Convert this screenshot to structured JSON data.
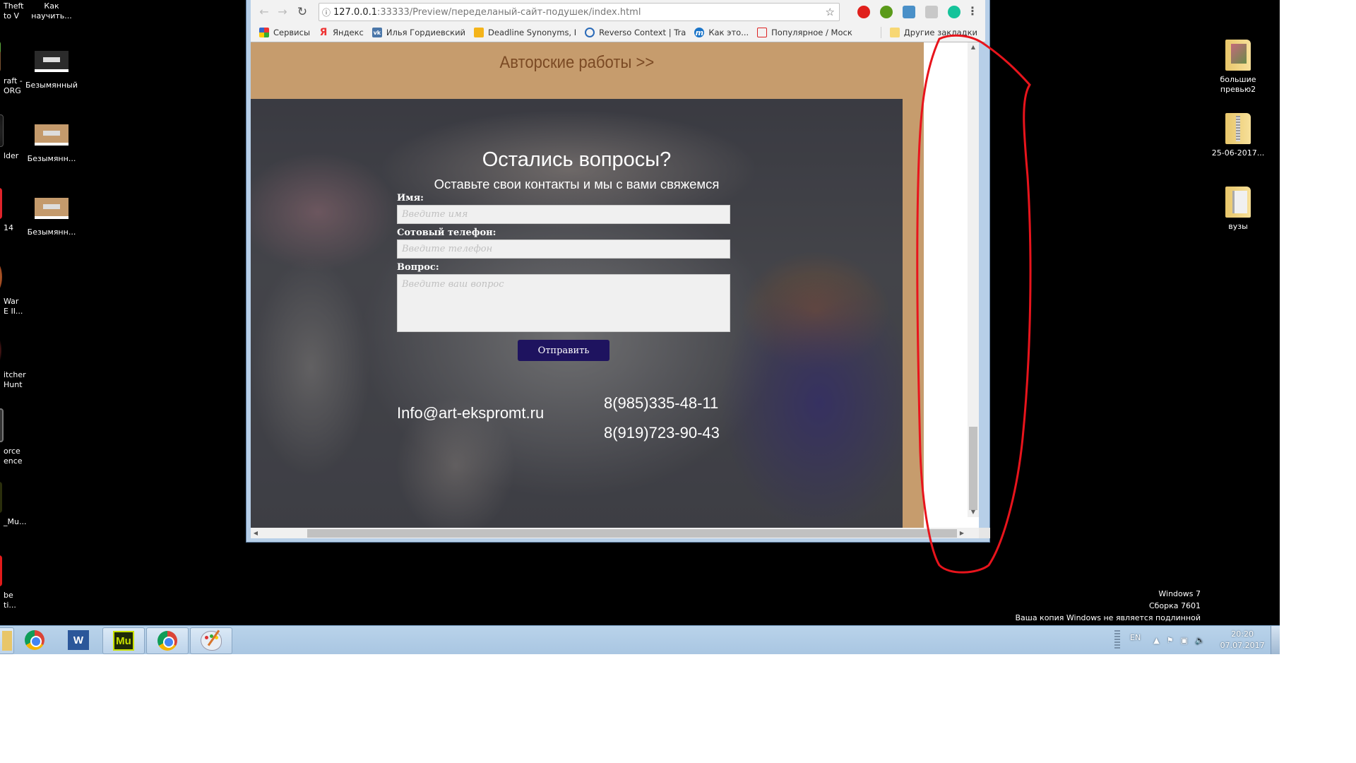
{
  "desktop": {
    "left_icons": [
      {
        "label": "Theft\nto V"
      },
      {
        "label": "Как\nнаучить..."
      },
      {
        "label": "raft -\nORG"
      },
      {
        "label": "Безымянный"
      },
      {
        "label": "lder"
      },
      {
        "label": "Безымянн..."
      },
      {
        "label": "14"
      },
      {
        "label": "Безымянн..."
      },
      {
        "label": "War\nE II..."
      },
      {
        "label": "itcher\nHunt"
      },
      {
        "label": "orce\nence"
      },
      {
        "label": "_Mu..."
      },
      {
        "label": "be\nti..."
      }
    ],
    "right_icons": [
      {
        "label": "большие превью2"
      },
      {
        "label": "25-06-2017..."
      },
      {
        "label": "вузы"
      }
    ],
    "watermark": {
      "line1": "Windows 7",
      "line2": "Сборка 7601",
      "line3": "Ваша копия Windows не является подлинной"
    }
  },
  "taskbar": {
    "apps": [
      "explorer",
      "chrome",
      "word",
      "muse",
      "chrome-active",
      "paint"
    ],
    "word_label": "W",
    "muse_label": "Mu",
    "tray": {
      "lang": "EN",
      "time": "20:20",
      "date": "07.07.2017"
    }
  },
  "browser": {
    "url_host": "127.0.0.1",
    "url_rest": ":33333/Preview/переделаный-сайт-подушек/index.html",
    "bookmarks": [
      {
        "label": "Сервисы",
        "icon": "apps-icon"
      },
      {
        "label": "Яндекс",
        "icon": "yandex-icon"
      },
      {
        "label": "Илья Гордиевский",
        "icon": "vk-icon"
      },
      {
        "label": "Deadline Synonyms, I",
        "icon": "deadline-icon"
      },
      {
        "label": "Reverso Context | Tra",
        "icon": "reverso-icon"
      },
      {
        "label": "Как это...",
        "icon": "m-icon"
      },
      {
        "label": "Популярное / Моск",
        "icon": "bookmark-icon"
      }
    ],
    "other_bookmarks": "Другие закладки"
  },
  "page": {
    "authors_link": "Авторские работы >>",
    "cta_title": "Остались вопросы?",
    "cta_subtitle": "Оставьте свои контакты и мы с вами свяжемся",
    "form": {
      "name_label": "Имя:",
      "name_placeholder": "Введите имя",
      "phone_label": "Сотовый телефон:",
      "phone_placeholder": "Введите телефон",
      "question_label": "Вопрос:",
      "question_placeholder": "Введите ваш вопрос",
      "submit": "Отправить"
    },
    "contacts": {
      "email": "Info@art-ekspromt.ru",
      "phone1": "8(985)335-48-11",
      "phone2": "8(919)723-90-43"
    }
  },
  "colors": {
    "tan": "#c69c6d",
    "link_brown": "#7b4a24",
    "button_navy": "#1e135f",
    "annotation_red": "#e8141c"
  }
}
